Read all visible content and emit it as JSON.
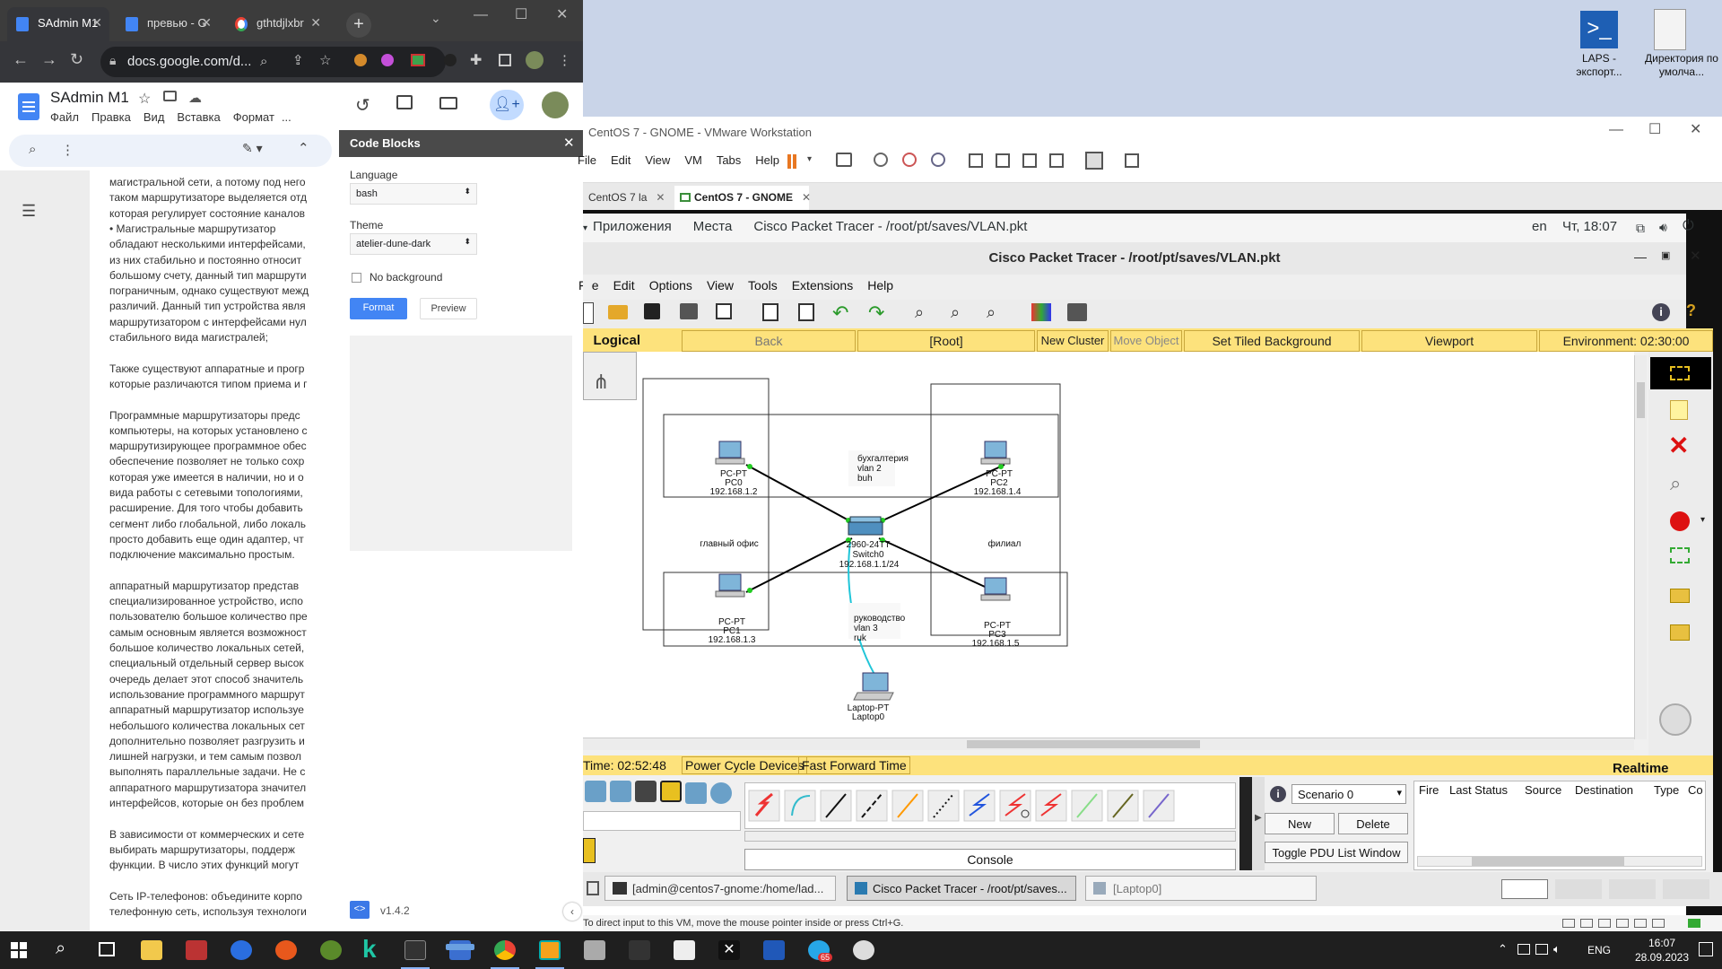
{
  "chrome": {
    "tabs": [
      {
        "label": "SAdmin M1"
      },
      {
        "label": "превью - G"
      },
      {
        "label": "gthtdjlxbr"
      }
    ],
    "url": "docs.google.com/d..."
  },
  "docs": {
    "title": "SAdmin M1",
    "menu": [
      "Файл",
      "Правка",
      "Вид",
      "Вставка",
      "Формат",
      "..."
    ],
    "paragraphs": [
      "магистральной сети, а потому под него",
      "таком маршрутизаторе выделяется отд",
      "которая регулирует состояние каналов",
      "•        Магистральные маршрутизатор",
      "обладают несколькими интерфейсами,",
      "из них стабильно и постоянно относит",
      "большому счету, данный тип маршрути",
      "пограничным, однако существуют межд",
      "различий. Данный тип устройства явля",
      "маршрутизатором с интерфейсами нул",
      "стабильного вида магистралей;",
      "",
      "Также существуют аппаратные и прогр",
      "которые различаются типом приема и г",
      "",
      "Программные маршрутизаторы предс",
      "компьютеры, на которых установлено с",
      "маршрутизирующее программное обес",
      "обеспечение позволяет не только сохр",
      "которая уже имеется в наличии, но и о",
      "вида работы с сетевыми топологиями,",
      "расширение. Для того чтобы добавить",
      "сегмент либо глобальной, либо локаль",
      "просто добавить еще один адаптер, чт",
      "подключение максимально простым.",
      "",
      "аппаратный маршрутизатор представ",
      "специализированное устройство, испо",
      "пользователю большое количество пре",
      "самым основным является возможност",
      "большое количество локальных сетей,",
      "специальный отдельный сервер высок",
      "очередь делает этот способ значитель",
      "использование программного маршрут",
      "аппаратный маршрутизатор используе",
      "небольшого количества локальных сет",
      "дополнительно позволяет разгрузить и",
      "лишней нагрузки, и тем самым позвол",
      "выполнять параллельные задачи. Не с",
      "аппаратного маршрутизатора значител",
      "интерфейсов, которые он без проблем",
      "",
      "В зависимости от коммерческих и сете",
      "выбирать маршрутизаторы, поддерж",
      "функции. В число этих функций могут",
      "",
      "Сеть IP-телефонов: объедините корпо",
      "телефонную сеть, используя технологи"
    ]
  },
  "codeblocks": {
    "title": "Code Blocks",
    "language_label": "Language",
    "language_value": "bash",
    "theme_label": "Theme",
    "theme_value": "atelier-dune-dark",
    "no_background_label": "No background",
    "format_label": "Format",
    "preview_label": "Preview",
    "version": "v1.4.2"
  },
  "desktop": {
    "icons": [
      {
        "label": "LAPS - экспорт..."
      },
      {
        "label": "Директория по умолча..."
      }
    ]
  },
  "vmware": {
    "title": "CentOS 7 - GNOME - VMware Workstation",
    "menu": [
      "File",
      "Edit",
      "View",
      "VM",
      "Tabs",
      "Help"
    ],
    "tabs": [
      {
        "label": "CentOS 7 la"
      },
      {
        "label": "CentOS 7 - GNOME"
      }
    ],
    "status": "To direct input to this VM, move the mouse pointer inside or press Ctrl+G."
  },
  "gnome": {
    "apps": "Приложения",
    "places": "Места",
    "window": "Cisco Packet Tracer - /root/pt/saves/VLAN.pkt",
    "lang": "en",
    "clock": "Чт, 18:07"
  },
  "pt": {
    "title": "Cisco Packet Tracer - /root/pt/saves/VLAN.pkt",
    "menu": [
      "File",
      "Edit",
      "Options",
      "View",
      "Tools",
      "Extensions",
      "Help"
    ],
    "logical": "Logical",
    "nav": {
      "back": "Back",
      "root": "[Root]",
      "new_cluster": "New Cluster",
      "move_object": "Move Object",
      "tiled_bg": "Set Tiled Background",
      "viewport": "Viewport",
      "environment": "Environment: 02:30:00"
    },
    "canvas": {
      "pc0": {
        "type": "PC-PT",
        "name": "PC0",
        "ip": "192.168.1.2"
      },
      "pc1": {
        "type": "PC-PT",
        "name": "PC1",
        "ip": "192.168.1.3"
      },
      "pc2": {
        "type": "PC-PT",
        "name": "PC2",
        "ip": "192.168.1.4"
      },
      "pc3": {
        "type": "PC-PT",
        "name": "PC3",
        "ip": "192.168.1.5"
      },
      "switch": {
        "model": "2960-24TT",
        "name": "Switch0",
        "ip": "192.168.1.1/24"
      },
      "laptop": {
        "type": "Laptop-PT",
        "name": "Laptop0"
      },
      "note_buh": [
        "бухгалтерия",
        "vlan 2",
        "buh"
      ],
      "note_ruk": [
        "руководство",
        "vlan 3",
        "ruk"
      ],
      "area_main": "главный офис",
      "area_branch": "филиал"
    },
    "time": "Time: 02:52:48",
    "power_cycle": "Power Cycle Devices",
    "fast_forward": "Fast Forward Time",
    "realtime": "Realtime",
    "console": "Console",
    "scenario": "Scenario 0",
    "new_btn": "New",
    "delete_btn": "Delete",
    "toggle_pdu": "Toggle PDU List Window",
    "pdu_cols": [
      "Fire",
      "Last Status",
      "Source",
      "Destination",
      "Type",
      "Co"
    ]
  },
  "vmtaskbar": [
    {
      "label": "[admin@centos7-gnome:/home/lad..."
    },
    {
      "label": "Cisco Packet Tracer - /root/pt/saves..."
    },
    {
      "label": "[Laptop0]"
    }
  ],
  "taskbar": {
    "lang": "ENG",
    "time": "16:07",
    "date": "28.09.2023",
    "badge": "65"
  }
}
